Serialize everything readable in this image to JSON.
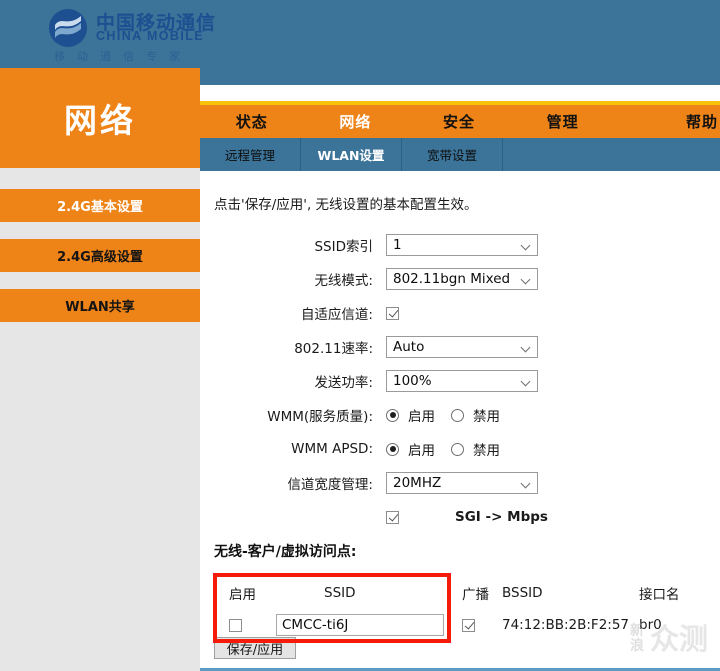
{
  "brand": {
    "logo_icon": "china-mobile-logo-icon",
    "name_cn": "中国移动通信",
    "name_en": "CHINA MOBILE",
    "slogan": "移动通信专家"
  },
  "page": {
    "title": "网络"
  },
  "primary_nav": {
    "items": [
      {
        "label": "状态",
        "active": false
      },
      {
        "label": "网络",
        "active": true
      },
      {
        "label": "安全",
        "active": false
      },
      {
        "label": "管理",
        "active": false
      },
      {
        "label": "帮助",
        "active": false
      }
    ]
  },
  "secondary_nav": {
    "items": [
      {
        "label": "远程管理",
        "active": false
      },
      {
        "label": "WLAN设置",
        "active": true
      },
      {
        "label": "宽带设置",
        "active": false
      }
    ]
  },
  "sidebar": {
    "items": [
      {
        "label": "2.4G基本设置",
        "active": true
      },
      {
        "label": "2.4G高级设置",
        "active": false
      },
      {
        "label": "WLAN共享",
        "active": false
      }
    ]
  },
  "main": {
    "intro": "点击'保存/应用', 无线设置的基本配置生效。",
    "fields": {
      "ssid_index": {
        "label": "SSID索引",
        "value": "1"
      },
      "wireless_mode": {
        "label": "无线模式:",
        "value": "802.11bgn Mixed"
      },
      "auto_channel": {
        "label": "自适应信道:",
        "checked": true
      },
      "rate_80211": {
        "label": "802.11速率:",
        "value": "Auto"
      },
      "tx_power": {
        "label": "发送功率:",
        "value": "100%"
      },
      "wmm_qos": {
        "label": "WMM(服务质量):",
        "enable_label": "启用",
        "disable_label": "禁用",
        "selected": "启用"
      },
      "wmm_apsd": {
        "label": "WMM APSD:",
        "enable_label": "启用",
        "disable_label": "禁用",
        "selected": "启用"
      },
      "channel_width": {
        "label": "信道宽度管理:",
        "value": "20MHZ"
      },
      "sgi": {
        "label": "SGI -> Mbps",
        "checked": true
      }
    },
    "vap": {
      "title": "无线-客户/虚拟访问点:",
      "columns": [
        "启用",
        "SSID",
        "广播",
        "BSSID",
        "接口名"
      ],
      "rows": [
        {
          "enabled": false,
          "ssid": "CMCC-ti6J",
          "broadcast": true,
          "bssid": "74:12:BB:2B:F2:57",
          "interface": "br0"
        }
      ]
    },
    "save_button": "保存/应用"
  },
  "annotation": {
    "highlight_color": "#f61b09"
  },
  "watermark": {
    "small": "新浪",
    "big": "众测"
  },
  "colors": {
    "orange": "#ee8318",
    "blue": "#3b7399",
    "gold": "#f7c20a",
    "sidebar_bg": "#e6e6e6"
  }
}
